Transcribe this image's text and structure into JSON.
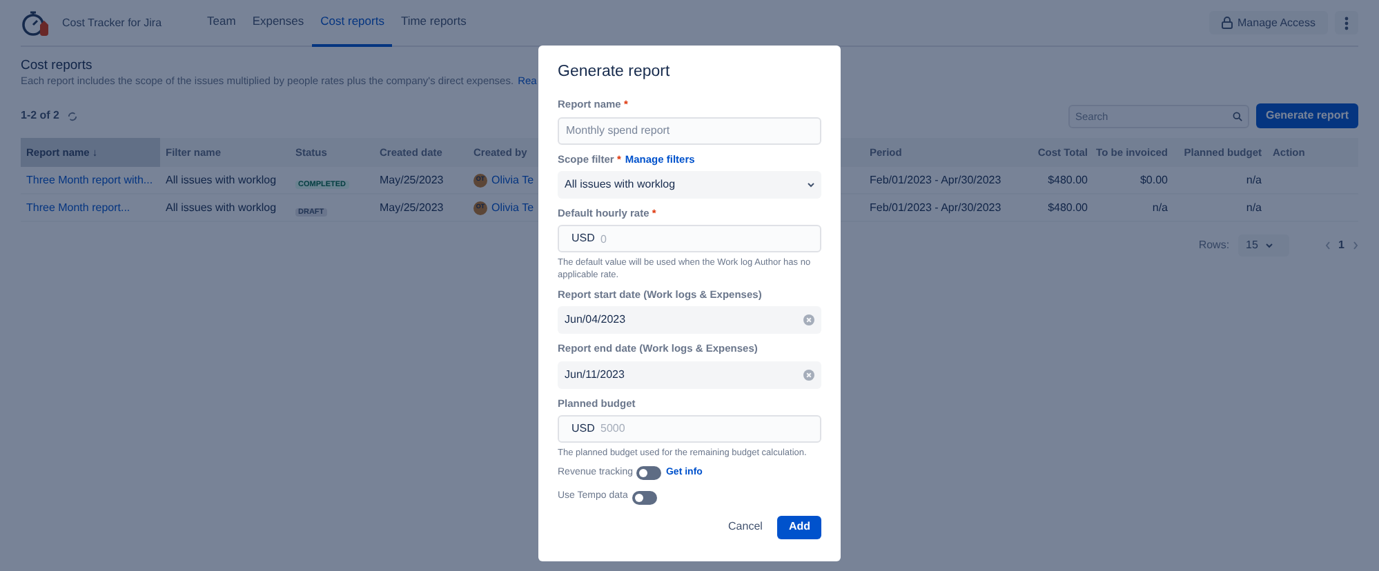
{
  "app": {
    "name": "Cost Tracker for Jira"
  },
  "nav": [
    {
      "label": "Team",
      "selected": false
    },
    {
      "label": "Expenses",
      "selected": false
    },
    {
      "label": "Cost reports",
      "selected": true
    },
    {
      "label": "Time reports",
      "selected": false
    }
  ],
  "header_actions": {
    "manage_access": "Manage Access"
  },
  "page": {
    "title": "Cost reports",
    "description": "Each report includes the scope of the issues multiplied by people rates plus the company's direct expenses.",
    "link": "Rea"
  },
  "count": "1-2 of 2",
  "search": {
    "placeholder": "Search"
  },
  "generate_button": "Generate report",
  "table": {
    "columns": [
      {
        "label": "Report name ↓",
        "selected": true
      },
      {
        "label": "Filter name",
        "selected": false
      },
      {
        "label": "Status",
        "selected": false
      },
      {
        "label": "Created date",
        "selected": false
      },
      {
        "label": "Created by",
        "selected": false
      },
      {
        "label": "Period",
        "selected": false
      },
      {
        "label": "Cost Total",
        "selected": false
      },
      {
        "label": "To be invoiced",
        "selected": false
      },
      {
        "label": "Planned budget",
        "selected": false
      },
      {
        "label": "Action",
        "selected": false
      }
    ],
    "rows": [
      {
        "name": "Three Month report with...",
        "filter": "All issues with worklog",
        "status": {
          "label": "COMPLETED",
          "kind": "completed"
        },
        "created": "May/25/2023",
        "initials": "OT",
        "creator": "Olivia Te",
        "period": "Feb/01/2023 - Apr/30/2023",
        "cost": "$480.00",
        "invoiced": "$0.00",
        "budget": "n/a"
      },
      {
        "name": "Three Month report...",
        "filter": "All issues with worklog",
        "status": {
          "label": "DRAFT",
          "kind": "draft"
        },
        "created": "May/25/2023",
        "initials": "OT",
        "creator": "Olivia Te",
        "period": "Feb/01/2023 - Apr/30/2023",
        "cost": "$480.00",
        "invoiced": "n/a",
        "budget": "n/a"
      }
    ]
  },
  "pagination": {
    "rows_label": "Rows:",
    "rows_value": "15",
    "page": "1"
  },
  "dialog": {
    "title": "Generate report",
    "report_name": {
      "label": "Report name",
      "required": "*",
      "placeholder": "Monthly spend report"
    },
    "scope_filter": {
      "label": "Scope filter",
      "required": "*",
      "link": "Manage filters",
      "value": "All issues with worklog"
    },
    "hourly_rate": {
      "label": "Default hourly rate",
      "required": "*",
      "prefix": "USD",
      "placeholder": "0",
      "help": "The default value will be used when the Work log Author has no applicable rate."
    },
    "start_date": {
      "label": "Report start date (Work logs & Expenses)",
      "value": "Jun/04/2023"
    },
    "end_date": {
      "label": "Report end date (Work logs & Expenses)",
      "value": "Jun/11/2023"
    },
    "planned_budget": {
      "label": "Planned budget",
      "prefix": "USD",
      "placeholder": "5000",
      "help": "The planned budget used for the remaining budget calculation."
    },
    "revenue_tracking": {
      "label": "Revenue tracking",
      "on": false,
      "link": "Get info"
    },
    "tempo": {
      "label": "Use Tempo data",
      "on": false
    },
    "cancel": "Cancel",
    "add": "Add"
  }
}
